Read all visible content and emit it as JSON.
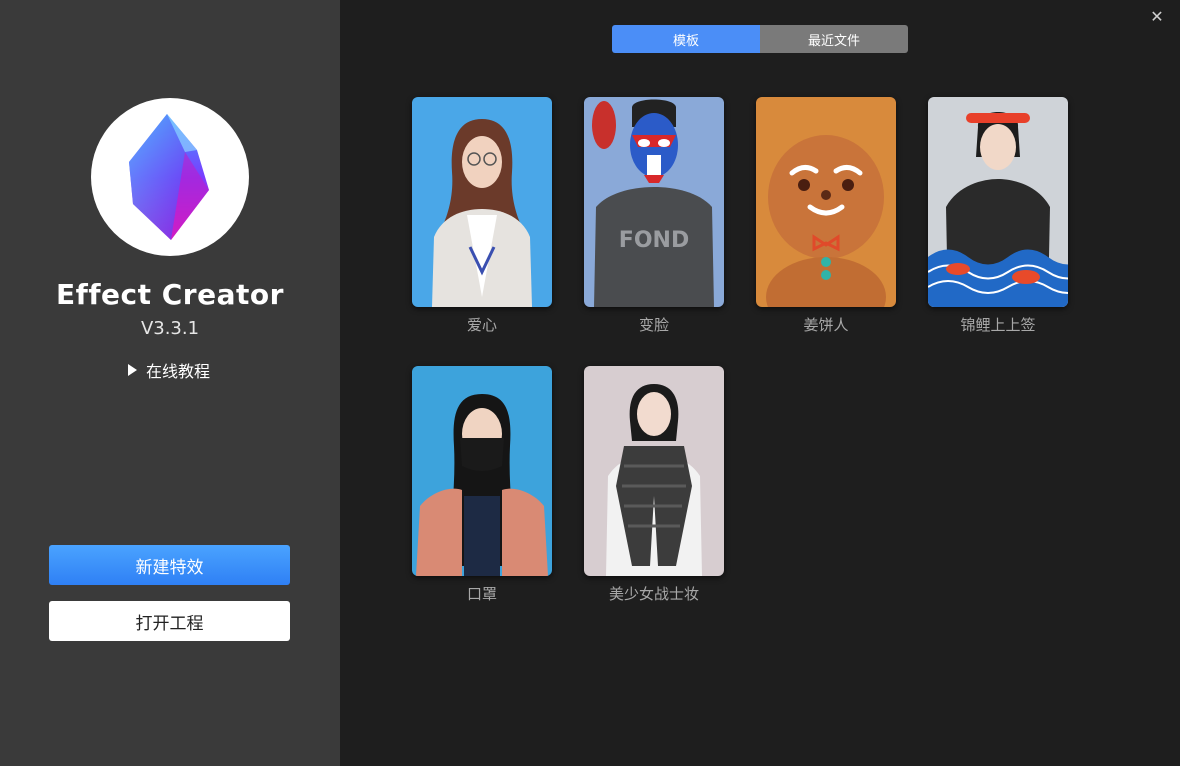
{
  "app": {
    "name": "Effect Creator",
    "version": "V3.3.1",
    "tutorial_label": "在线教程",
    "logo_icon": "crystal-gem-icon"
  },
  "actions": {
    "new_effect_label": "新建特效",
    "open_project_label": "打开工程"
  },
  "tabs": [
    {
      "label": "模板",
      "active": true
    },
    {
      "label": "最近文件",
      "active": false
    }
  ],
  "templates": [
    {
      "label": "爱心",
      "thumb": "woman-glasses-photo"
    },
    {
      "label": "变脸",
      "thumb": "opera-face-mask-photo"
    },
    {
      "label": "姜饼人",
      "thumb": "gingerbread-man-face-photo"
    },
    {
      "label": "锦鲤上上签",
      "thumb": "koi-fish-photo"
    },
    {
      "label": "口罩",
      "thumb": "face-mask-photo"
    },
    {
      "label": "美少女战士妆",
      "thumb": "scarf-woman-photo"
    }
  ],
  "colors": {
    "sidebar_bg": "#3a3a3a",
    "main_bg": "#1e1e1e",
    "accent": "#4b8ef7",
    "inactive_tab": "#7a7a7a"
  }
}
